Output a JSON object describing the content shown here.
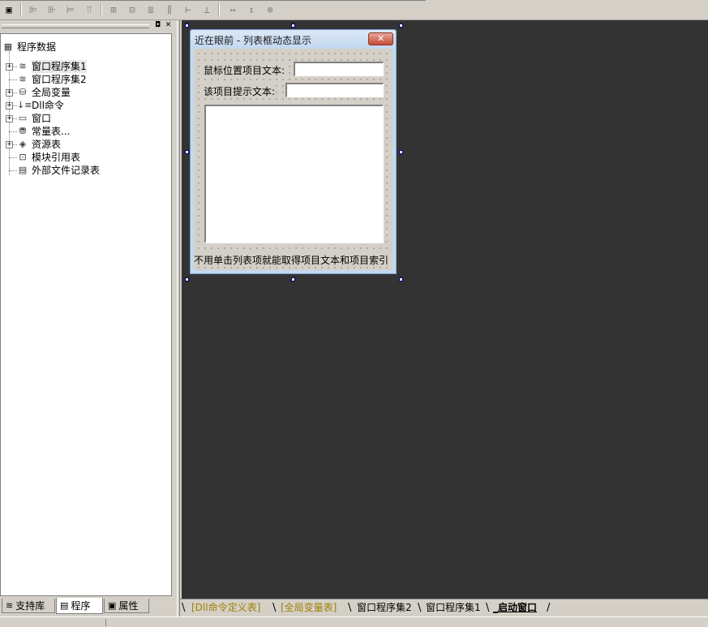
{
  "toolbar": {
    "icons": [
      "form-icon",
      "align-left-icon",
      "align-center-icon",
      "align-right-icon",
      "align-top-icon",
      "align-middle-icon",
      "align-bottom-icon",
      "same-width-icon",
      "same-height-icon",
      "same-size-icon",
      "h-spacing-icon",
      "v-spacing-icon",
      "center-h-icon",
      "center-v-icon"
    ]
  },
  "left_panel": {
    "tree": {
      "root": "程序数据",
      "items": [
        {
          "label": "窗口程序集1",
          "expandable": true
        },
        {
          "label": "窗口程序集2",
          "expandable": false
        },
        {
          "label": "全局变量",
          "expandable": true
        },
        {
          "label": "Dll命令",
          "expandable": true
        },
        {
          "label": "窗口",
          "expandable": true
        },
        {
          "label": "常量表...",
          "expandable": false
        },
        {
          "label": "资源表",
          "expandable": true
        },
        {
          "label": "模块引用表",
          "expandable": false
        },
        {
          "label": "外部文件记录表",
          "expandable": false
        }
      ]
    },
    "tabs": [
      {
        "label": "支持库",
        "active": false
      },
      {
        "label": "程序",
        "active": true
      },
      {
        "label": "属性",
        "active": false
      }
    ]
  },
  "form": {
    "title": "近在眼前 - 列表框动态显示",
    "close_label": "✕",
    "label_mouse": "鼠标位置项目文本:",
    "label_tip": "该项目提示文本:",
    "input_mouse_value": "",
    "input_tip_value": "",
    "footer": "不用单击列表项就能取得项目文本和项目索引"
  },
  "bottom_tabs": [
    {
      "label": "[Dll命令定义表]",
      "style": "yellow"
    },
    {
      "label": "[全局变量表]",
      "style": "yellow"
    },
    {
      "label": "窗口程序集2",
      "style": "normal"
    },
    {
      "label": "窗口程序集1",
      "style": "normal"
    },
    {
      "label": "_启动窗口",
      "style": "active"
    }
  ],
  "colors": {
    "design_background": "#333333",
    "panel_background": "#d4d0c8",
    "title_gradient_top": "#dce9f7",
    "close_button": "#c44a35",
    "tab_yellow": "#a08000"
  }
}
